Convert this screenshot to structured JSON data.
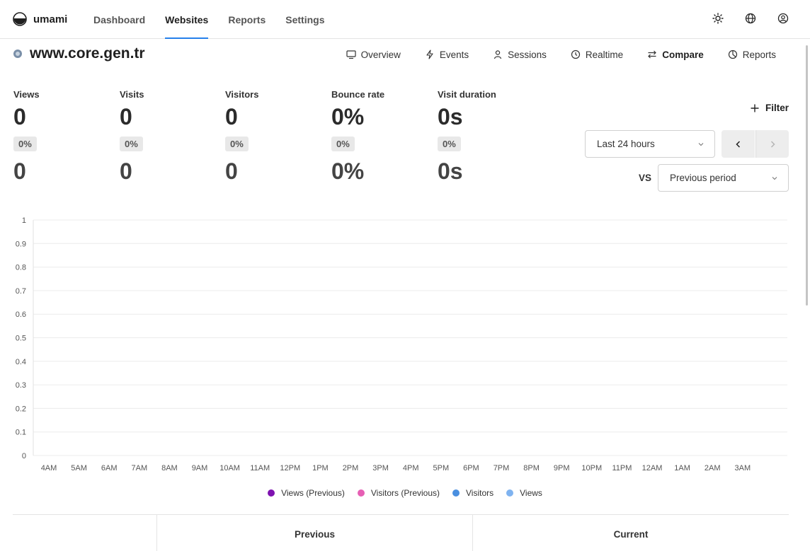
{
  "app": {
    "name": "umami"
  },
  "nav": {
    "links": [
      {
        "label": "Dashboard",
        "active": false
      },
      {
        "label": "Websites",
        "active": true
      },
      {
        "label": "Reports",
        "active": false
      },
      {
        "label": "Settings",
        "active": false
      }
    ],
    "icons": [
      "sun-icon",
      "globe-icon",
      "user-icon"
    ]
  },
  "website": {
    "name": "www.core.gen.tr"
  },
  "subnav": [
    {
      "label": "Overview",
      "icon": "monitor-icon",
      "active": false
    },
    {
      "label": "Events",
      "icon": "bolt-icon",
      "active": false
    },
    {
      "label": "Sessions",
      "icon": "user-icon",
      "active": false
    },
    {
      "label": "Realtime",
      "icon": "clock-icon",
      "active": false
    },
    {
      "label": "Compare",
      "icon": "arrows-icon",
      "active": true
    },
    {
      "label": "Reports",
      "icon": "pie-icon",
      "active": false
    }
  ],
  "metrics": [
    {
      "label": "Views",
      "value": "0",
      "change": "0%",
      "previous": "0"
    },
    {
      "label": "Visits",
      "value": "0",
      "change": "0%",
      "previous": "0"
    },
    {
      "label": "Visitors",
      "value": "0",
      "change": "0%",
      "previous": "0"
    },
    {
      "label": "Bounce rate",
      "value": "0%",
      "change": "0%",
      "previous": "0%"
    },
    {
      "label": "Visit duration",
      "value": "0s",
      "change": "0%",
      "previous": "0s"
    }
  ],
  "controls": {
    "filter_label": "Filter",
    "date_range": "Last 24 hours",
    "vs_label": "VS",
    "compare_mode": "Previous period"
  },
  "chart_data": {
    "type": "bar",
    "categories": [
      "4AM",
      "5AM",
      "6AM",
      "7AM",
      "8AM",
      "9AM",
      "10AM",
      "11AM",
      "12PM",
      "1PM",
      "2PM",
      "3PM",
      "4PM",
      "5PM",
      "6PM",
      "7PM",
      "8PM",
      "9PM",
      "10PM",
      "11PM",
      "12AM",
      "1AM",
      "2AM",
      "3AM"
    ],
    "yticks": [
      "0",
      "0.1",
      "0.2",
      "0.3",
      "0.4",
      "0.5",
      "0.6",
      "0.7",
      "0.8",
      "0.9",
      "1"
    ],
    "ylim": [
      0,
      1
    ],
    "grid": true,
    "legend_position": "bottom",
    "series": [
      {
        "name": "Views (Previous)",
        "color": "#7e12b0",
        "values": [
          0,
          0,
          0,
          0,
          0,
          0,
          0,
          0,
          0,
          0,
          0,
          0,
          0,
          0,
          0,
          0,
          0,
          0,
          0,
          0,
          0,
          0,
          0,
          0
        ]
      },
      {
        "name": "Visitors (Previous)",
        "color": "#e65fb4",
        "values": [
          0,
          0,
          0,
          0,
          0,
          0,
          0,
          0,
          0,
          0,
          0,
          0,
          0,
          0,
          0,
          0,
          0,
          0,
          0,
          0,
          0,
          0,
          0,
          0
        ]
      },
      {
        "name": "Visitors",
        "color": "#4a8fe0",
        "values": [
          0,
          0,
          0,
          0,
          0,
          0,
          0,
          0,
          0,
          0,
          0,
          0,
          0,
          0,
          0,
          0,
          0,
          0,
          0,
          0,
          0,
          0,
          0,
          0
        ]
      },
      {
        "name": "Views",
        "color": "#7fb3f0",
        "values": [
          0,
          0,
          0,
          0,
          0,
          0,
          0,
          0,
          0,
          0,
          0,
          0,
          0,
          0,
          0,
          0,
          0,
          0,
          0,
          0,
          0,
          0,
          0,
          0
        ]
      }
    ]
  },
  "table": {
    "columns": [
      "",
      "Previous",
      "Current"
    ]
  }
}
